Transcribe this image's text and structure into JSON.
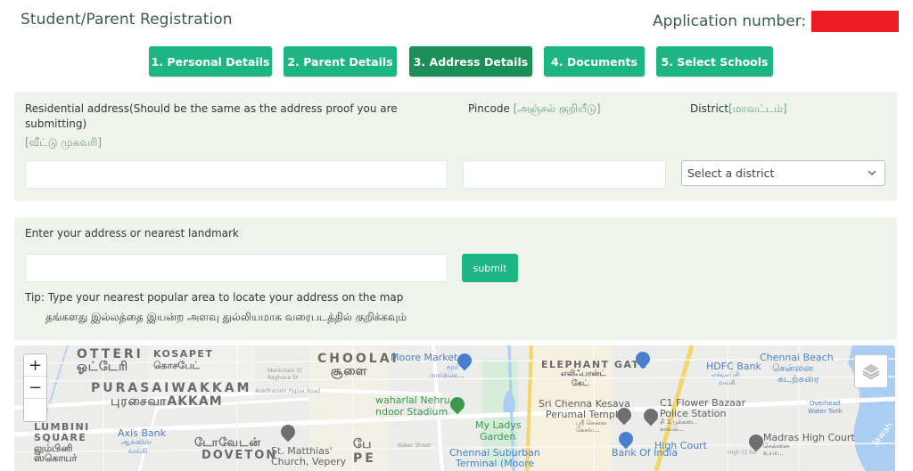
{
  "header": {
    "title": "Student/Parent Registration",
    "application_number_label": "Application number:",
    "application_number_redacted_color": "#ec1c24"
  },
  "steps": [
    {
      "label": "1. Personal Details",
      "active": false
    },
    {
      "label": "2. Parent Details",
      "active": false
    },
    {
      "label": "3. Address Details",
      "active": true
    },
    {
      "label": "4. Documents",
      "active": false
    },
    {
      "label": "5. Select Schools",
      "active": false
    }
  ],
  "address_form": {
    "residential_label": "Residential address(Should be the same as the address proof you are submitting)",
    "residential_label_tamil": "[வீட்டு முகவரி]",
    "residential_value": "",
    "pincode_label": "Pincode",
    "pincode_label_tamil": "[அஞ்சல் குறியீடு]",
    "pincode_value": "",
    "district_label": "District",
    "district_label_tamil": "[மாவட்டம்]",
    "district_selected": "Select a district"
  },
  "landmark_form": {
    "label": "Enter your address or nearest landmark",
    "value": "",
    "submit_label": "submit",
    "tip": "Tip: Type your nearest popular area to locate your address on the map",
    "tip_tamil": "தங்களது இல்லத்தை இயன்ற அளவு துல்லியமாக வரைபடத்தில் குறிக்கவும்"
  },
  "map": {
    "zoom_in": "+",
    "zoom_out": "−",
    "labels": {
      "otteri": "OTTERI",
      "otteri_ta": "ஓட்டேரி",
      "kosapet": "KOSAPET",
      "kosapet_ta": "கொசபேட்",
      "purasaiwakkam": "PURASAIWAKKAM",
      "purasaiwakkam_ta": "புரசைவாAKKAM",
      "lumbini": "LUMBINI",
      "square": "SQUARE",
      "lumbini_ta1": "லும்பினி",
      "lumbini_ta2": "ஸ்கொயர்",
      "axis_bank": "Axis Bank",
      "axis_bank_ta1": "ஆக்ஸிஸ்",
      "axis_bank_ta2": "வங்கி",
      "doveton_ta": "டோவேடன்",
      "doveton": "DOVETON",
      "st_matthias1": "St. Matthias'",
      "st_matthias2": "Church, Vepery",
      "choolai": "CHOOLAI",
      "choolai_ta": "சூளை",
      "moore_market": "Moore Market",
      "moore_market_ta1": "மூர்",
      "moore_market_ta2": "மார்க்கெ...",
      "nehru_stadium1": "waharlal Nehru",
      "nehru_stadium2": "ndoor Stadium",
      "my_ladys1": "My Ladys",
      "my_ladys2": "Garden",
      "pe_ta": "பே",
      "pe": "PE",
      "chennai_suburban1": "Chennai Suburban",
      "chennai_suburban2": "Terminal (Moore",
      "elephant_gate": "ELEPHANT GATE",
      "elephant_gate_ta1": "எலிஃபான்ட்",
      "elephant_gate_ta2": "கேட்",
      "sri_chenna1": "Sri Chenna Kesava",
      "sri_chenna2": "Perumal Temple",
      "sri_chenna_ta1": "ஸ்ரீ சென்ன",
      "sri_chenna_ta2": "கேசவ...",
      "hdfc": "HDFC Bank",
      "hdfc_ta1": "எச்டிஎப்சி",
      "hdfc_ta2": "வங்கி",
      "c1_flower1": "C1 Flower Bazaar",
      "c1_flower2": "Police Station",
      "c1_flower_ta1": "சி 1 பூக்கடை",
      "c1_flower_ta2": "காவல்...",
      "chennai_beach": "Chennai Beach",
      "chennai_beach_ta1": "சென்னை",
      "chennai_beach_ta2": "கடற்கரை",
      "overhead1": "Overhead",
      "overhead2": "Water Tank",
      "high_court_metro": "High Court",
      "madras_hc": "Madras High Court",
      "madras_hc_ta1": "சென்னை",
      "madras_hc_ta2": "உயர்...",
      "bank_of_india": "Bank Of India",
      "police_station": "Police Station",
      "avadhanam": "Avadhanam Papiar Road",
      "manickam": "Manickam St",
      "raghava": "Raghava St",
      "baker": "Baker Street",
      "high_ct_rd": "High Ct Rd",
      "jawahar": "Jawah"
    }
  }
}
